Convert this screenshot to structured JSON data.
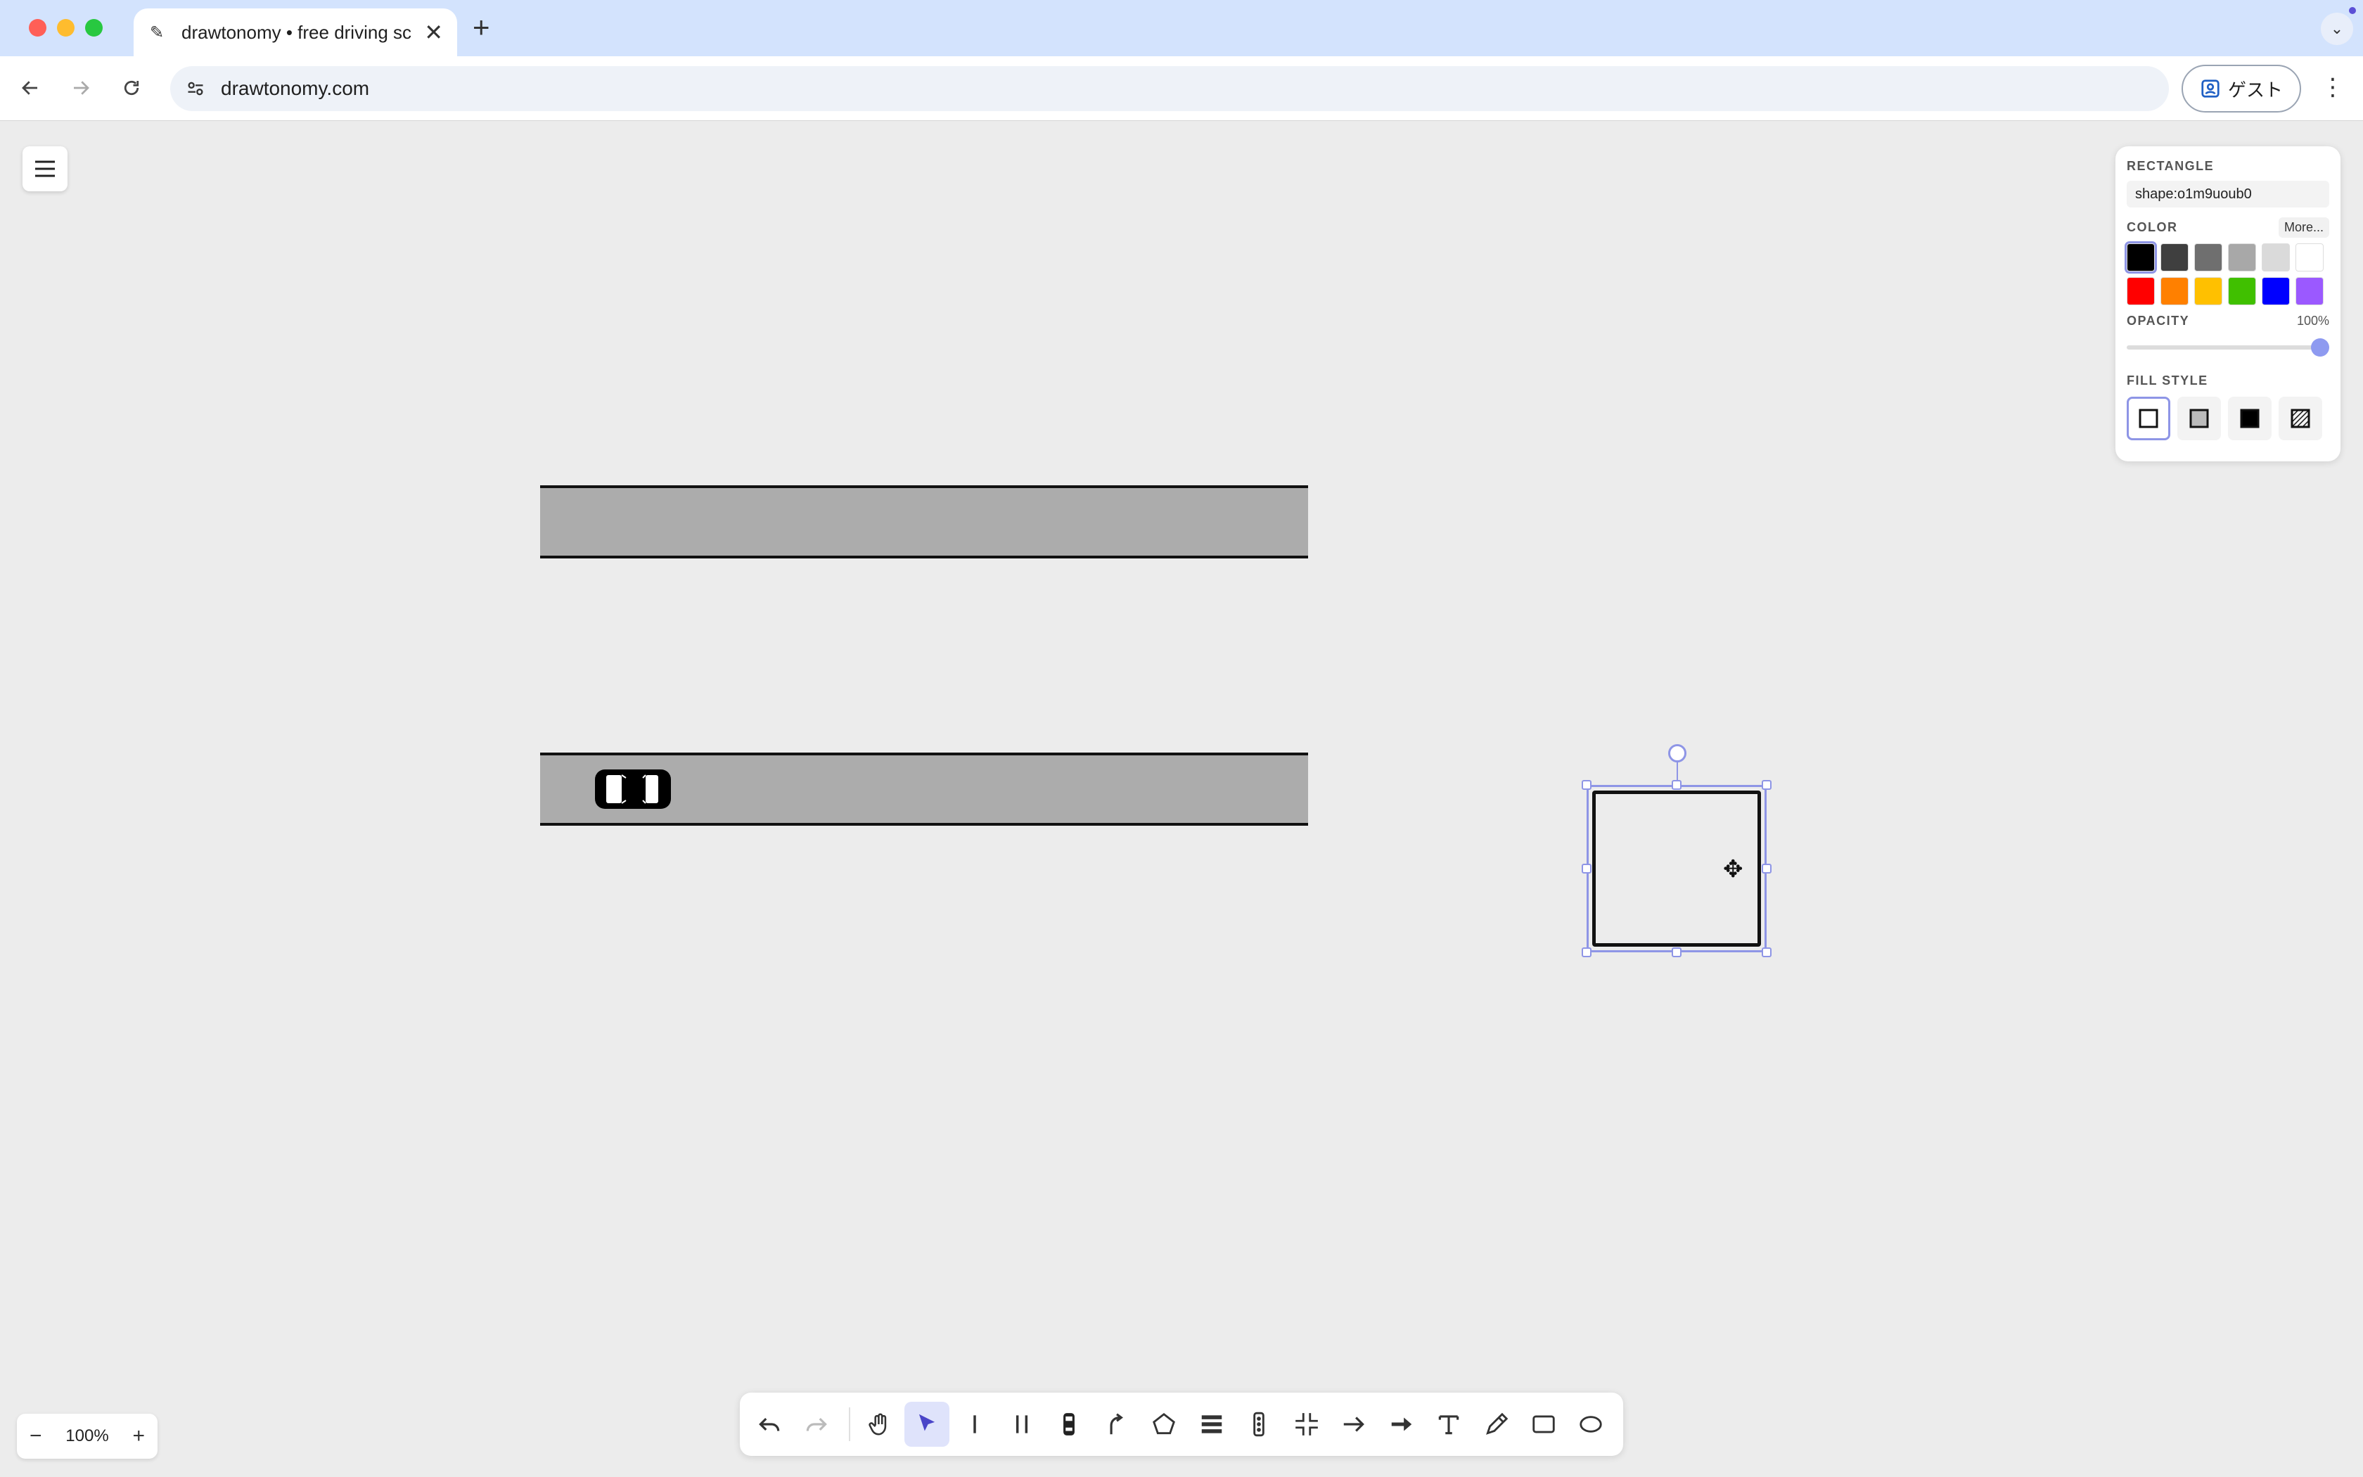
{
  "browser": {
    "tab_title": "drawtonomy • free driving sc",
    "url": "drawtonomy.com",
    "profile_label": "ゲスト"
  },
  "panel": {
    "type_label": "RECTANGLE",
    "shape_id": "shape:o1m9uoub0",
    "color_label": "COLOR",
    "more_label": "More...",
    "opacity_label": "OPACITY",
    "opacity_value": "100%",
    "opacity_fraction": 1.0,
    "fill_label": "FILL STYLE",
    "colors": [
      "#000000",
      "#3f3f3f",
      "#6f6f6f",
      "#a8a8a8",
      "#dadada",
      "#ffffff",
      "#ff0000",
      "#ff8000",
      "#ffc000",
      "#40c000",
      "#0000ff",
      "#9b59ff"
    ],
    "selected_color": "#000000",
    "fill_styles": [
      "none",
      "semi",
      "solid",
      "pattern"
    ],
    "selected_fill": "none"
  },
  "zoom": {
    "value": "100%",
    "minus": "−",
    "plus": "+"
  },
  "tools": [
    "undo",
    "redo",
    "hand",
    "select",
    "lane",
    "double-lane",
    "vehicle",
    "path",
    "polygon",
    "crosswalk",
    "traffic-light",
    "intersection",
    "arrow",
    "thick-arrow",
    "text",
    "pencil",
    "rectangle",
    "ellipse"
  ],
  "active_tool": "select"
}
